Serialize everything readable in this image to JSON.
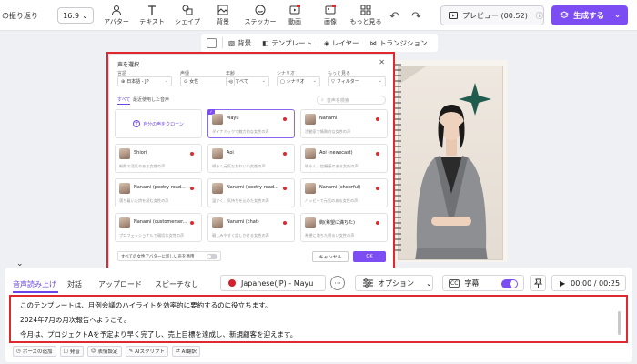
{
  "toolbar": {
    "title": "の振り返り",
    "ratio": "16:9",
    "tools": [
      {
        "label": "アバター",
        "icon": "avatar-icon"
      },
      {
        "label": "テキスト",
        "icon": "text-icon"
      },
      {
        "label": "シェイプ",
        "icon": "shape-icon"
      },
      {
        "label": "背景",
        "icon": "background-icon"
      },
      {
        "label": "ステッカー",
        "icon": "sticker-icon"
      },
      {
        "label": "動画",
        "icon": "video-icon"
      },
      {
        "label": "画像",
        "icon": "image-icon"
      },
      {
        "label": "もっと見る",
        "icon": "more-icon"
      }
    ],
    "preview_label": "プレビュー (00:52)",
    "generate_label": "生成する"
  },
  "subbar": {
    "background": "背景",
    "template": "テンプレート",
    "layer": "レイヤー",
    "transition": "トランジション"
  },
  "dialog": {
    "title": "声を選択",
    "filters": [
      {
        "label": "言語",
        "value": "日本語 - JP"
      },
      {
        "label": "声優",
        "value": "女性"
      },
      {
        "label": "年齢",
        "value": "すべて"
      },
      {
        "label": "シナリオ",
        "value": "シナリオ"
      },
      {
        "label": "もっと見る",
        "value": "フィルター"
      }
    ],
    "tabs": [
      "すべて",
      "最近使用した音声"
    ],
    "search_placeholder": "音声を検索",
    "clone_label": "自分の声をクローン",
    "voices": [
      {
        "name": "Mayu",
        "desc": "ダイナミックで魅力的な女性の声",
        "selected": true
      },
      {
        "name": "Nanami",
        "desc": "活動家で情熱的な女性の声"
      },
      {
        "name": "Shiori",
        "desc": "新鮮で活気のある女性の声"
      },
      {
        "name": "Aoi",
        "desc": "明るく元気なかわいい女性の声"
      },
      {
        "name": "Aoi (newscast)",
        "desc": "明るく、信頼感のある女性の声"
      },
      {
        "name": "Nanami (cheerful)",
        "desc": "ハッピーで元気のある女性の声"
      },
      {
        "name": "Nanami (poetry-read...",
        "desc": "落ち着いた詩を読む女性の声"
      },
      {
        "name": "Nanami (poetry-read...",
        "desc": "温かく、気持ちを込めた女性の声"
      },
      {
        "name": "Nanami (customerser...",
        "desc": "プロフェッショナルで親切な女性の声"
      },
      {
        "name": "Nanami (chat)",
        "desc": "親しみやすく話しかける女性の声"
      },
      {
        "name": "絢(希望に満ちた)",
        "desc": "希望に満ちた明るい女性の声"
      }
    ],
    "apply_all_label": "すべての女性アバターに新しい声を適用",
    "cancel_label": "キャンセル",
    "ok_label": "OK"
  },
  "bottom": {
    "tabs": [
      "音声読み上げ",
      "対話",
      "アップロード",
      "スピーチなし"
    ],
    "voice_label": "Japanese(JP) - Mayu",
    "options_label": "オプション",
    "subtitle_label": "字幕",
    "time_label": "00:00 / 00:25",
    "script_lines": [
      "このテンプレートは、月例会議のハイライトを効率的に要約するのに役立ちます。",
      "2024年7月の月次報告へようこそ。",
      "今月は、プロジェクトAを予定より早く完了し、売上目標を達成し、新規顧客を迎えます。"
    ],
    "chips": [
      {
        "label": "ポーズの追加",
        "icon": "clock-icon"
      },
      {
        "label": "発音",
        "icon": "pronunciation-icon"
      },
      {
        "label": "表情設定",
        "icon": "smile-icon"
      },
      {
        "label": "AIスクリプト",
        "icon": "ai-script-icon"
      },
      {
        "label": "AI翻訳",
        "icon": "translate-icon"
      }
    ]
  },
  "colors": {
    "accent": "#7b4df2",
    "highlight": "#e0282e"
  }
}
